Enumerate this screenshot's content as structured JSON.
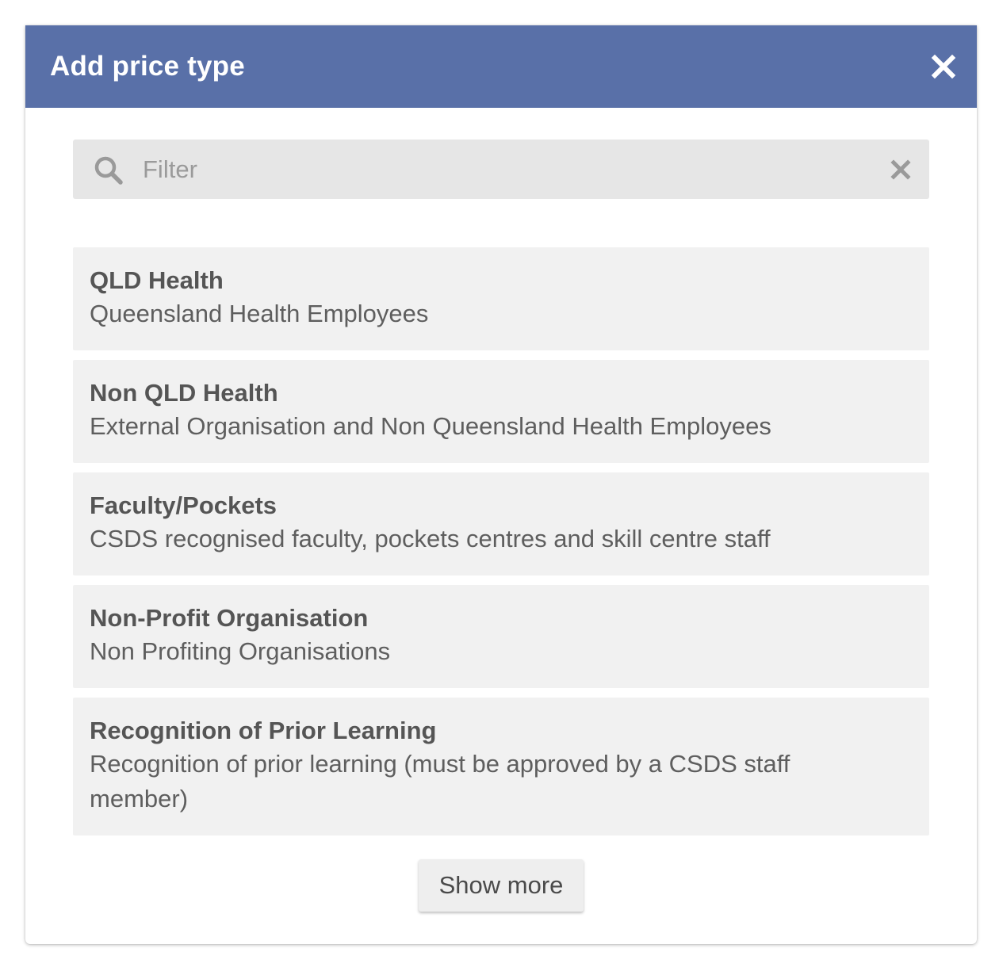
{
  "dialog": {
    "title": "Add price type",
    "close_icon": "close-icon",
    "header_color": "#5970a8"
  },
  "filter": {
    "placeholder": "Filter",
    "value": "",
    "search_icon": "search-icon",
    "clear_icon": "clear-icon"
  },
  "price_types": [
    {
      "name": "QLD Health",
      "description": "Queensland Health Employees"
    },
    {
      "name": "Non QLD Health",
      "description": "External Organisation and Non Queensland Health Employees"
    },
    {
      "name": "Faculty/Pockets",
      "description": "CSDS recognised faculty, pockets centres and skill centre staff"
    },
    {
      "name": "Non-Profit Organisation",
      "description": "Non Profiting Organisations"
    },
    {
      "name": "Recognition of Prior Learning",
      "description": "Recognition of prior learning (must be approved by a CSDS staff member)"
    }
  ],
  "show_more_label": "Show more"
}
